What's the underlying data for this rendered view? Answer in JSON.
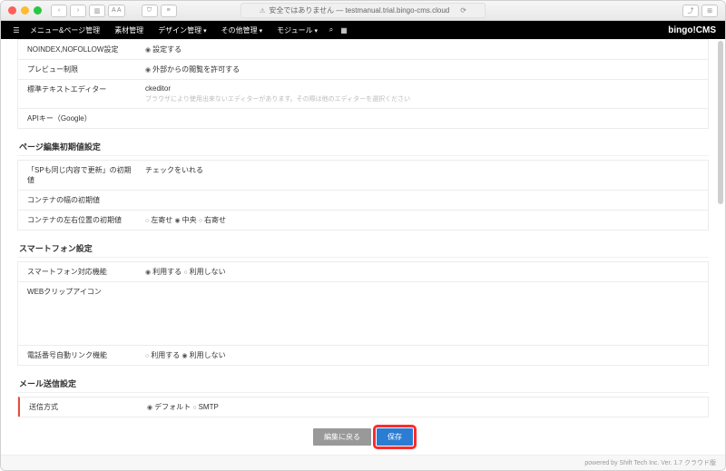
{
  "browser": {
    "address": "安全ではありません — testmanual.trial.bingo-cms.cloud"
  },
  "appbar": {
    "menu1": "メニュー&ページ管理",
    "menu2": "素材管理",
    "menu3": "デザイン管理",
    "menu4": "その他管理",
    "menu5": "モジュール",
    "logo": "bingo!CMS"
  },
  "rows": {
    "noindex": {
      "label": "NOINDEX,NOFOLLOW設定",
      "opt1": "設定する"
    },
    "preview": {
      "label": "プレビュー制限",
      "opt1": "外部からの閲覧を許可する"
    },
    "editor": {
      "label": "標準テキストエディター",
      "val": "ckeditor",
      "sub": "ブラウザにより使用出来ないエディターがあります。その際は他のエディターを選択ください"
    },
    "apikey": {
      "label": "APIキー（Google）"
    }
  },
  "sec2": {
    "title": "ページ編集初期値設定",
    "r1": {
      "label": "「SPも同じ内容で更新」の初期値",
      "val": "チェックをいれる"
    },
    "r2": {
      "label": "コンテナの幅の初期値"
    },
    "r3": {
      "label": "コンテナの左右位置の初期値",
      "o1": "左寄せ",
      "o2": "中央",
      "o3": "右寄せ"
    }
  },
  "sec3": {
    "title": "スマートフォン設定",
    "r1": {
      "label": "スマートフォン対応機能",
      "o1": "利用する",
      "o2": "利用しない"
    },
    "r2": {
      "label": "WEBクリップアイコン"
    },
    "r3": {
      "label": "電話番号自動リンク機能",
      "o1": "利用する",
      "o2": "利用しない"
    }
  },
  "sec4": {
    "title": "メール送信設定",
    "r1": {
      "label": "送信方式",
      "o1": "デフォルト",
      "o2": "SMTP"
    }
  },
  "buttons": {
    "back": "編集に戻る",
    "save": "保存"
  },
  "footer": "powered by Shift Tech Inc. Ver. 1.7 クラウド版"
}
